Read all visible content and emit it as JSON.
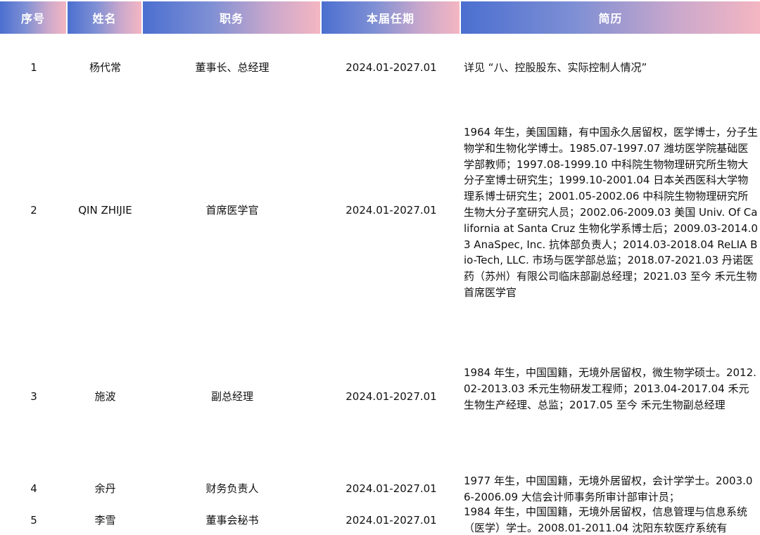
{
  "header": {
    "seq": "序号",
    "name": "姓名",
    "position": "职务",
    "term": "本届任期",
    "resume": "简历"
  },
  "rows": [
    {
      "seq": "1",
      "name": "杨代常",
      "position": "董事长、总经理",
      "term": "2024.01-2027.01",
      "resume": "详见 “八、控股股东、实际控制人情况”"
    },
    {
      "seq": "2",
      "name": "QIN ZHIJIE",
      "position": "首席医学官",
      "term": "2024.01-2027.01",
      "resume": "1964 年生，美国国籍，有中国永久居留权，医学博士，分子生物学和生物化学博士。1985.07-1997.07 潍坊医学院基础医学部教师；1997.08-1999.10 中科院生物物理研究所生物大分子室博士研究生；1999.10-2001.04 日本关西医科大学物理系博士研究生；2001.05-2002.06 中科院生物物理研究所生物大分子室研究人员；2002.06-2009.03 美国 Univ. Of California at Santa Cruz 生物化学系博士后；2009.03-2014.03 AnaSpec, Inc. 抗体部负责人；2014.03-2018.04 ReLIA Bio-Tech, LLC. 市场与医学部总监；2018.07-2021.03 丹诺医药（苏州）有限公司临床部副总经理；2021.03 至今 禾元生物首席医学官"
    },
    {
      "seq": "3",
      "name": "施波",
      "position": "副总经理",
      "term": "2024.01-2027.01",
      "resume": "1984 年生，中国国籍，无境外居留权，微生物学硕士。2012.02-2013.03 禾元生物研发工程师；2013.04-2017.04 禾元生物生产经理、总监；2017.05 至今 禾元生物副总经理"
    },
    {
      "seq": "4",
      "name": "余丹",
      "position": "财务负责人",
      "term": "2024.01-2027.01",
      "resume": "1977 年生，中国国籍，无境外居留权，会计学学士。2003.06-2006.09 大信会计师事务所审计部审计员；"
    },
    {
      "seq": "5",
      "name": "李雪",
      "position": "董事会秘书",
      "term": "2024.01-2027.01",
      "resume": "1984 年生，中国国籍，无境外居留权，信息管理与信息系统（医学）学士。2008.01-2011.04 沈阳东软医疗系统有"
    }
  ]
}
